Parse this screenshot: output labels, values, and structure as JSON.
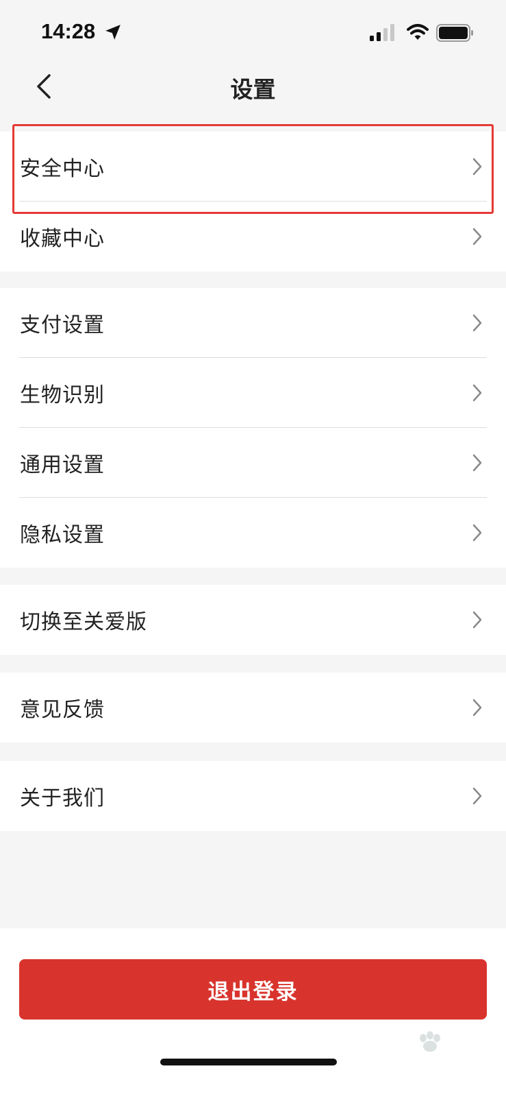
{
  "status_bar": {
    "time": "14:28",
    "icons": [
      "location-arrow-icon",
      "cellular-signal-icon",
      "wifi-icon",
      "battery-icon"
    ]
  },
  "nav": {
    "title": "设置",
    "back_icon": "chevron-left-icon"
  },
  "groups": [
    {
      "items": [
        {
          "label": "安全中心",
          "highlighted": true
        },
        {
          "label": "收藏中心"
        }
      ]
    },
    {
      "items": [
        {
          "label": "支付设置"
        },
        {
          "label": "生物识别"
        },
        {
          "label": "通用设置"
        },
        {
          "label": "隐私设置"
        }
      ]
    },
    {
      "items": [
        {
          "label": "切换至关爱版"
        }
      ]
    },
    {
      "items": [
        {
          "label": "意见反馈"
        }
      ]
    },
    {
      "items": [
        {
          "label": "关于我们"
        }
      ]
    }
  ],
  "logout": {
    "label": "退出登录"
  },
  "colors": {
    "accent_red": "#d8342d",
    "highlight_border": "#e53935",
    "background": "#f5f5f5",
    "card": "#ffffff"
  }
}
